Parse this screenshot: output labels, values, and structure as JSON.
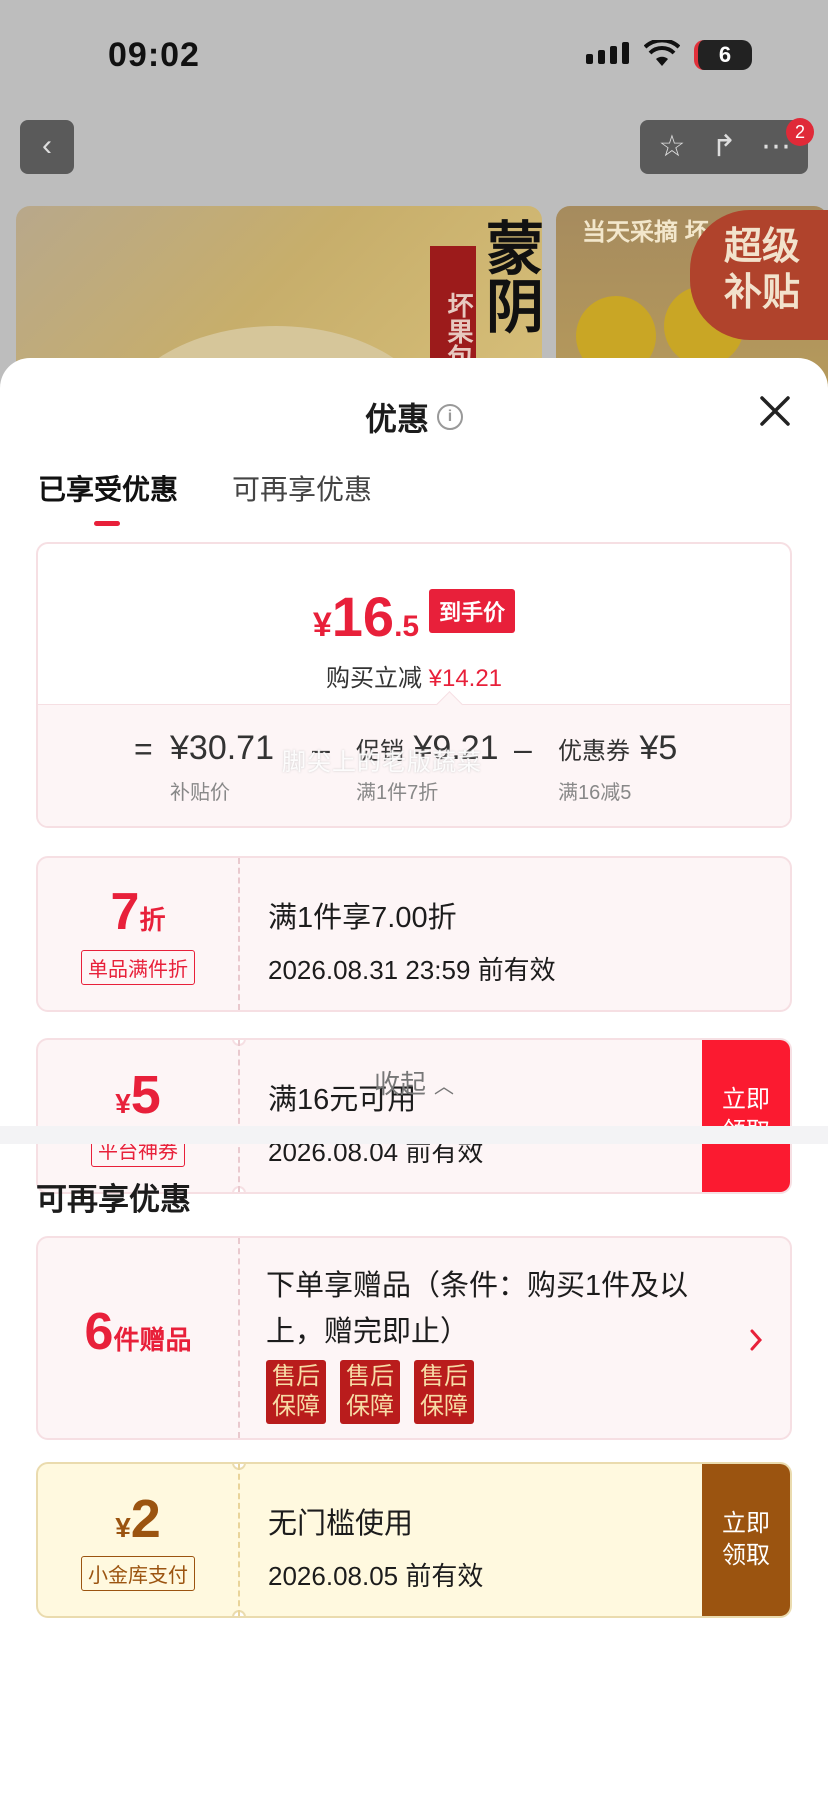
{
  "status_bar": {
    "time": "09:02",
    "battery": "6"
  },
  "nav": {
    "badge_count": "2"
  },
  "background": {
    "banner_left_vertical": "坏果包赔",
    "banner_left_big": "蒙阴",
    "banner_right_top": "当天采摘 坏",
    "subsidy_line1": "超级",
    "subsidy_line2": "补贴"
  },
  "sheet": {
    "title": "优惠",
    "info_icon_glyph": "i",
    "tabs": [
      {
        "label": "已享受优惠",
        "active": true
      },
      {
        "label": "可再享优惠",
        "active": false
      }
    ]
  },
  "price_summary": {
    "yen": "¥",
    "price_int": "16",
    "price_dec": ".5",
    "tag": "到手价",
    "instant_cut_label": "购买立减",
    "instant_cut_value": "¥14.21",
    "equals": "=",
    "minus": "–",
    "items": [
      {
        "main": "¥30.71",
        "sub": "补贴价"
      },
      {
        "prefix": "促销",
        "main": "¥9.21",
        "sub": "满1件7折"
      },
      {
        "prefix": "优惠券",
        "main": "¥5",
        "sub": "满16减5"
      }
    ]
  },
  "watermark": "脚尖上的老版蔬菜",
  "enjoyed_coupons": [
    {
      "big": "7",
      "big_suffix": "折",
      "label": "单品满件折",
      "title": "满1件享7.00折",
      "date": "2026.08.31 23:59 前有效"
    },
    {
      "big_prefix": "¥",
      "big": "5",
      "label": "平台神券",
      "title": "满16元可用",
      "date": "2026.08.04 前有效",
      "button": "立即领取"
    }
  ],
  "collapse_label": "收起",
  "more_section_title": "可再享优惠",
  "gift": {
    "big": "6",
    "big_suffix": "件赠品",
    "title_line1": "下单享赠品（条件：购买1件及以",
    "title_line2": "上，赠完即止）",
    "tags": [
      "售后保障",
      "售后保障",
      "售后保障"
    ]
  },
  "gold_coupon": {
    "big_prefix": "¥",
    "big": "2",
    "label": "小金库支付",
    "title": "无门槛使用",
    "date": "2026.08.05 前有效",
    "button": "立即领取"
  },
  "colors": {
    "accent_red": "#e8203a",
    "gold": "#9b5410"
  }
}
